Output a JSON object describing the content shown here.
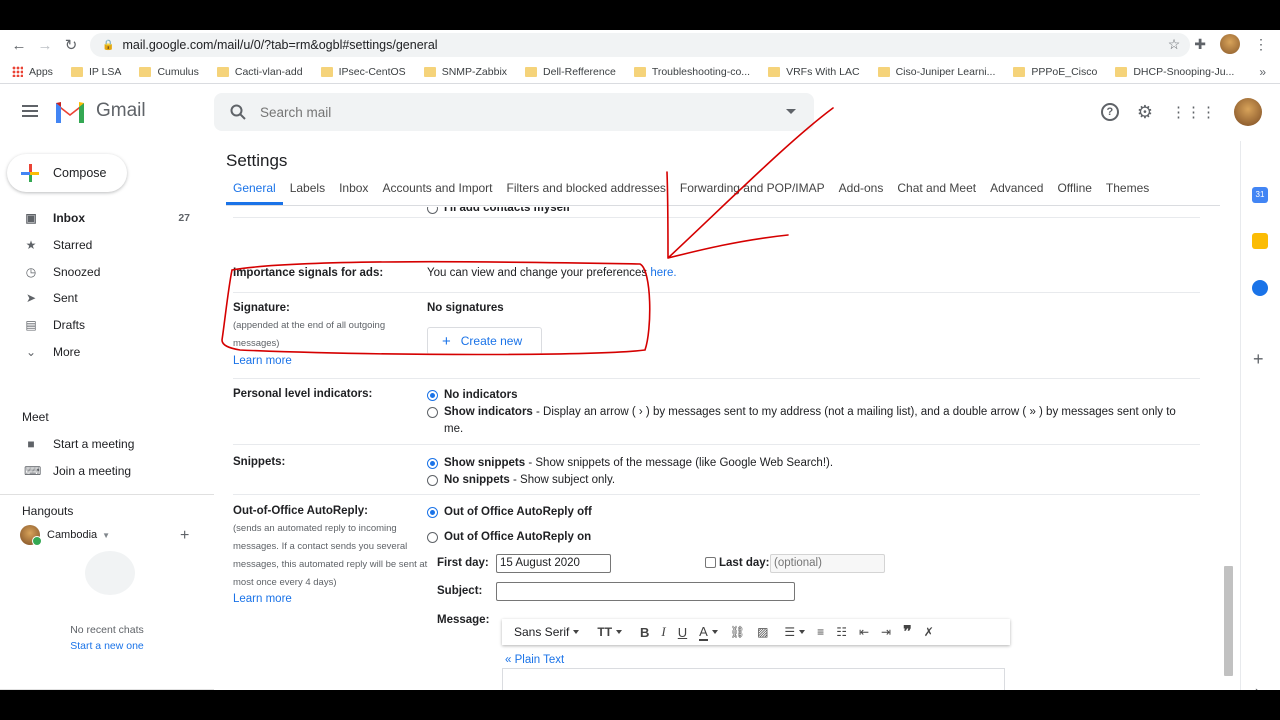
{
  "browser": {
    "url": "mail.google.com/mail/u/0/?tab=rm&ogbl#settings/general",
    "bookmarks": [
      "Apps",
      "IP LSA",
      "Cumulus",
      "Cacti-vlan-add",
      "IPsec-CentOS",
      "SNMP-Zabbix",
      "Dell-Refference",
      "Troubleshooting-co...",
      "VRFs With LAC",
      "Ciso-Juniper Learni...",
      "PPPoE_Cisco",
      "DHCP-Snooping-Ju..."
    ]
  },
  "header": {
    "logo_text": "Gmail",
    "search_placeholder": "Search mail"
  },
  "sidebar": {
    "compose": "Compose",
    "items": [
      {
        "label": "Inbox",
        "count": "27",
        "icon": "inbox-icon"
      },
      {
        "label": "Starred",
        "count": "",
        "icon": "star-icon"
      },
      {
        "label": "Snoozed",
        "count": "",
        "icon": "clock-icon"
      },
      {
        "label": "Sent",
        "count": "",
        "icon": "send-icon"
      },
      {
        "label": "Drafts",
        "count": "",
        "icon": "draft-icon"
      },
      {
        "label": "More",
        "count": "",
        "icon": "chevron-down-icon"
      }
    ],
    "meet": {
      "title": "Meet",
      "start": "Start a meeting",
      "join": "Join a meeting"
    },
    "hangouts": {
      "title": "Hangouts",
      "user": "Cambodia",
      "no_chats": "No recent chats",
      "start_new": "Start a new one"
    }
  },
  "settings": {
    "title": "Settings",
    "tabs": [
      "General",
      "Labels",
      "Inbox",
      "Accounts and Import",
      "Filters and blocked addresses",
      "Forwarding and POP/IMAP",
      "Add-ons",
      "Chat and Meet",
      "Advanced",
      "Offline",
      "Themes"
    ],
    "active_tab": "General",
    "partial_row": "I'll add contacts myself",
    "importance": {
      "label": "Importance signals for ads:",
      "text": "You can view and change your preferences",
      "link": "here."
    },
    "signature": {
      "label": "Signature:",
      "sub": "(appended at the end of all outgoing messages)",
      "learn": "Learn more",
      "value": "No signatures",
      "button": "Create new"
    },
    "personal": {
      "label": "Personal level indicators:",
      "opt1": "No indicators",
      "opt2_b": "Show indicators",
      "opt2_rest": " - Display an arrow ( › ) by messages sent to my address (not a mailing list), and a double arrow ( » ) by messages sent only to",
      "opt2_tail": "me."
    },
    "snippets": {
      "label": "Snippets:",
      "opt1_b": "Show snippets",
      "opt1_rest": " - Show snippets of the message (like Google Web Search!).",
      "opt2_b": "No snippets",
      "opt2_rest": " - Show subject only."
    },
    "ooo": {
      "label": "Out-of-Office AutoReply:",
      "sub": "(sends an automated reply to incoming messages. If a contact sends you several messages, this automated reply will be sent at most once every 4 days)",
      "learn": "Learn more",
      "off": "Out of Office AutoReply off",
      "on": "Out of Office AutoReply on",
      "first_day_label": "First day:",
      "first_day_value": "15 August 2020",
      "last_day_label": "Last day:",
      "last_day_placeholder": "(optional)",
      "subject_label": "Subject:",
      "message_label": "Message:",
      "font": "Sans Serif",
      "plain_text": "« Plain Text"
    }
  },
  "colors": {
    "accent": "#1a73e8",
    "annotation": "#d50000"
  }
}
